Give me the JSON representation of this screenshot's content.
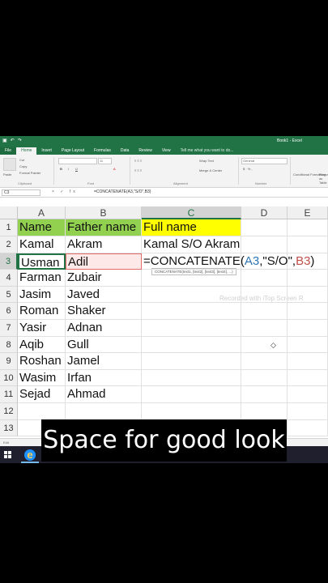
{
  "window": {
    "title": "Book1 - Excel"
  },
  "ribbon": {
    "tabs": [
      "File",
      "Home",
      "Insert",
      "Page Layout",
      "Formulas",
      "Data",
      "Review",
      "View"
    ],
    "tell_me": "Tell me what you want to do...",
    "clipboard": {
      "paste": "Paste",
      "cut": "Cut",
      "copy": "Copy",
      "format_painter": "Format Painter",
      "label": "Clipboard"
    },
    "font": {
      "size": "11",
      "label": "Font"
    },
    "alignment": {
      "wrap": "Wrap Text",
      "merge": "Merge & Center",
      "label": "Alignment"
    },
    "number": {
      "format": "General",
      "label": "Number"
    },
    "styles": {
      "conditional": "Conditional Formatting",
      "format_as": "Format as Table"
    }
  },
  "formula_bar": {
    "name_box": "C3",
    "fx": "× ✓ fx",
    "formula": "=CONCATENATE(A3,\"S/O\",B3)"
  },
  "columns": [
    "A",
    "B",
    "C",
    "D",
    "E"
  ],
  "rows": [
    "1",
    "2",
    "3",
    "4",
    "5",
    "6",
    "7",
    "8",
    "9",
    "10",
    "11",
    "12",
    "13"
  ],
  "cells": {
    "A1": "Name",
    "B1": "Father name",
    "C1": "Full name",
    "A2": "Kamal",
    "B2": "Akram",
    "C2": "Kamal S/O Akram",
    "A3": "Usman",
    "B3": "Adil",
    "A4": "Farman",
    "B4": "Zubair",
    "A5": "Jasim",
    "B5": "Javed",
    "A6": "Roman",
    "B6": "Shaker",
    "A7": "Yasir",
    "B7": "Adnan",
    "A8": "Aqib",
    "B8": "Gull",
    "A9": "Roshan",
    "B9": "Jamel",
    "A10": "Wasim",
    "B10": "Irfan",
    "A11": "Sejad",
    "B11": "Ahmad"
  },
  "edit_cell": {
    "prefix": "=CONCATENATE(",
    "ref1": "A3",
    "mid": ",\"S/O\",",
    "ref2": "B3",
    "suffix": ")"
  },
  "tooltip": "CONCATENATE(text1, [text2], [text3], [text4], ...)",
  "watermark": "Recorded with iTop Screen R",
  "status": {
    "mode": "Edit"
  },
  "caption": "Space for good look",
  "colors": {
    "excel_green": "#217346",
    "header_green_fill": "#92d050",
    "header_yellow_fill": "#ffff00"
  }
}
